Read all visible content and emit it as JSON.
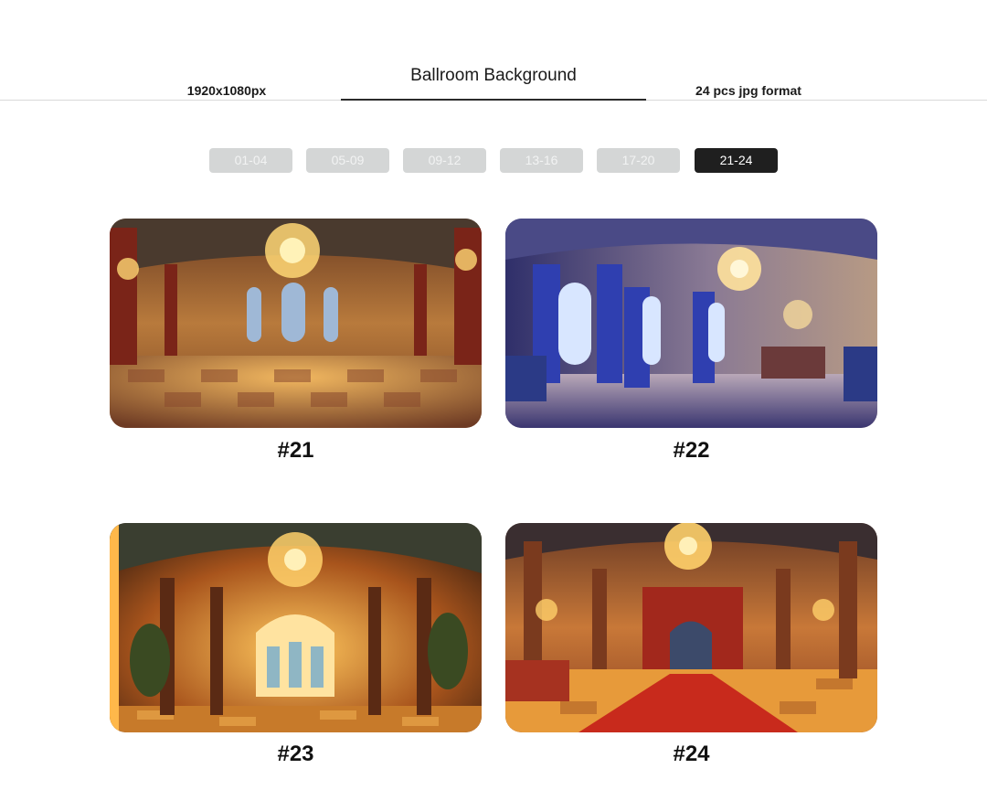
{
  "header": {
    "title": "Ballroom Background",
    "resolution": "1920x1080px",
    "format": "24 pcs jpg format"
  },
  "tabs": [
    {
      "label": "01-04",
      "active": false
    },
    {
      "label": "05-09",
      "active": false
    },
    {
      "label": "09-12",
      "active": false
    },
    {
      "label": "13-16",
      "active": false
    },
    {
      "label": "17-20",
      "active": false
    },
    {
      "label": "21-24",
      "active": true
    }
  ],
  "gallery": [
    {
      "caption": "#21",
      "theme": "golden-ballroom-checker-floor"
    },
    {
      "caption": "#22",
      "theme": "blue-curtain-ballroom"
    },
    {
      "caption": "#23",
      "theme": "golden-arched-hall"
    },
    {
      "caption": "#24",
      "theme": "red-carpet-hall"
    }
  ]
}
